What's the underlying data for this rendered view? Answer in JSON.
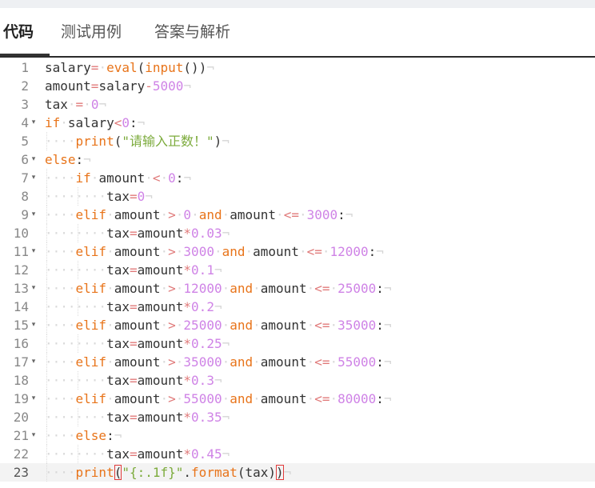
{
  "tabs": [
    {
      "label": "代码",
      "active": true
    },
    {
      "label": "测试用例",
      "active": false
    },
    {
      "label": "答案与解析",
      "active": false
    }
  ],
  "editor": {
    "indent_marker": "····",
    "eol_marker": "¬",
    "fold_marker": "▾",
    "active_line": 23,
    "colors": {
      "keyword": "#e8741a",
      "operator": "#e07a7a",
      "number": "#cf83e6",
      "string": "#7cab3c",
      "identifier": "#333333"
    },
    "lines": [
      {
        "n": "1",
        "indent": 0,
        "fold": false,
        "tokens": [
          [
            "ident",
            "salary"
          ],
          [
            "op",
            "="
          ],
          [
            "ws",
            "·"
          ],
          [
            "func",
            "eval"
          ],
          [
            "punct",
            "("
          ],
          [
            "func",
            "input"
          ],
          [
            "punct",
            "())"
          ]
        ]
      },
      {
        "n": "2",
        "indent": 0,
        "fold": false,
        "tokens": [
          [
            "ident",
            "amount"
          ],
          [
            "op",
            "="
          ],
          [
            "ident",
            "salary"
          ],
          [
            "op",
            "-"
          ],
          [
            "num",
            "5000"
          ]
        ]
      },
      {
        "n": "3",
        "indent": 0,
        "fold": false,
        "tokens": [
          [
            "ident",
            "tax"
          ],
          [
            "ws",
            "·"
          ],
          [
            "op",
            "="
          ],
          [
            "ws",
            "·"
          ],
          [
            "num",
            "0"
          ]
        ]
      },
      {
        "n": "4",
        "indent": 0,
        "fold": true,
        "tokens": [
          [
            "kw",
            "if"
          ],
          [
            "ws",
            "·"
          ],
          [
            "ident",
            "salary"
          ],
          [
            "op",
            "<"
          ],
          [
            "num",
            "0"
          ],
          [
            "punct",
            ":"
          ]
        ]
      },
      {
        "n": "5",
        "indent": 1,
        "fold": false,
        "tokens": [
          [
            "func",
            "print"
          ],
          [
            "punct",
            "("
          ],
          [
            "str",
            "\"请输入正数！\""
          ],
          [
            "punct",
            ")"
          ]
        ]
      },
      {
        "n": "6",
        "indent": 0,
        "fold": true,
        "tokens": [
          [
            "kw",
            "else"
          ],
          [
            "punct",
            ":"
          ]
        ]
      },
      {
        "n": "7",
        "indent": 1,
        "fold": true,
        "tokens": [
          [
            "kw",
            "if"
          ],
          [
            "ws",
            "·"
          ],
          [
            "ident",
            "amount"
          ],
          [
            "ws",
            "·"
          ],
          [
            "op",
            "<"
          ],
          [
            "ws",
            "·"
          ],
          [
            "num",
            "0"
          ],
          [
            "punct",
            ":"
          ]
        ]
      },
      {
        "n": "8",
        "indent": 2,
        "fold": false,
        "tokens": [
          [
            "ident",
            "tax"
          ],
          [
            "op",
            "="
          ],
          [
            "num",
            "0"
          ]
        ]
      },
      {
        "n": "9",
        "indent": 1,
        "fold": true,
        "tokens": [
          [
            "kw",
            "elif"
          ],
          [
            "ws",
            "·"
          ],
          [
            "ident",
            "amount"
          ],
          [
            "ws",
            "·"
          ],
          [
            "op",
            ">"
          ],
          [
            "ws",
            "·"
          ],
          [
            "num",
            "0"
          ],
          [
            "ws",
            "·"
          ],
          [
            "kw",
            "and"
          ],
          [
            "ws",
            "·"
          ],
          [
            "ident",
            "amount"
          ],
          [
            "ws",
            "·"
          ],
          [
            "op",
            "<="
          ],
          [
            "ws",
            "·"
          ],
          [
            "num",
            "3000"
          ],
          [
            "punct",
            ":"
          ]
        ]
      },
      {
        "n": "10",
        "indent": 2,
        "fold": false,
        "tokens": [
          [
            "ident",
            "tax"
          ],
          [
            "op",
            "="
          ],
          [
            "ident",
            "amount"
          ],
          [
            "op",
            "*"
          ],
          [
            "num",
            "0.03"
          ]
        ]
      },
      {
        "n": "11",
        "indent": 1,
        "fold": true,
        "tokens": [
          [
            "kw",
            "elif"
          ],
          [
            "ws",
            "·"
          ],
          [
            "ident",
            "amount"
          ],
          [
            "ws",
            "·"
          ],
          [
            "op",
            ">"
          ],
          [
            "ws",
            "·"
          ],
          [
            "num",
            "3000"
          ],
          [
            "ws",
            "·"
          ],
          [
            "kw",
            "and"
          ],
          [
            "ws",
            "·"
          ],
          [
            "ident",
            "amount"
          ],
          [
            "ws",
            "·"
          ],
          [
            "op",
            "<="
          ],
          [
            "ws",
            "·"
          ],
          [
            "num",
            "12000"
          ],
          [
            "punct",
            ":"
          ]
        ]
      },
      {
        "n": "12",
        "indent": 2,
        "fold": false,
        "tokens": [
          [
            "ident",
            "tax"
          ],
          [
            "op",
            "="
          ],
          [
            "ident",
            "amount"
          ],
          [
            "op",
            "*"
          ],
          [
            "num",
            "0.1"
          ]
        ]
      },
      {
        "n": "13",
        "indent": 1,
        "fold": true,
        "tokens": [
          [
            "kw",
            "elif"
          ],
          [
            "ws",
            "·"
          ],
          [
            "ident",
            "amount"
          ],
          [
            "ws",
            "·"
          ],
          [
            "op",
            ">"
          ],
          [
            "ws",
            "·"
          ],
          [
            "num",
            "12000"
          ],
          [
            "ws",
            "·"
          ],
          [
            "kw",
            "and"
          ],
          [
            "ws",
            "·"
          ],
          [
            "ident",
            "amount"
          ],
          [
            "ws",
            "·"
          ],
          [
            "op",
            "<="
          ],
          [
            "ws",
            "·"
          ],
          [
            "num",
            "25000"
          ],
          [
            "punct",
            ":"
          ]
        ]
      },
      {
        "n": "14",
        "indent": 2,
        "fold": false,
        "tokens": [
          [
            "ident",
            "tax"
          ],
          [
            "op",
            "="
          ],
          [
            "ident",
            "amount"
          ],
          [
            "op",
            "*"
          ],
          [
            "num",
            "0.2"
          ]
        ]
      },
      {
        "n": "15",
        "indent": 1,
        "fold": true,
        "tokens": [
          [
            "kw",
            "elif"
          ],
          [
            "ws",
            "·"
          ],
          [
            "ident",
            "amount"
          ],
          [
            "ws",
            "·"
          ],
          [
            "op",
            ">"
          ],
          [
            "ws",
            "·"
          ],
          [
            "num",
            "25000"
          ],
          [
            "ws",
            "·"
          ],
          [
            "kw",
            "and"
          ],
          [
            "ws",
            "·"
          ],
          [
            "ident",
            "amount"
          ],
          [
            "ws",
            "·"
          ],
          [
            "op",
            "<="
          ],
          [
            "ws",
            "·"
          ],
          [
            "num",
            "35000"
          ],
          [
            "punct",
            ":"
          ]
        ]
      },
      {
        "n": "16",
        "indent": 2,
        "fold": false,
        "tokens": [
          [
            "ident",
            "tax"
          ],
          [
            "op",
            "="
          ],
          [
            "ident",
            "amount"
          ],
          [
            "op",
            "*"
          ],
          [
            "num",
            "0.25"
          ]
        ]
      },
      {
        "n": "17",
        "indent": 1,
        "fold": true,
        "tokens": [
          [
            "kw",
            "elif"
          ],
          [
            "ws",
            "·"
          ],
          [
            "ident",
            "amount"
          ],
          [
            "ws",
            "·"
          ],
          [
            "op",
            ">"
          ],
          [
            "ws",
            "·"
          ],
          [
            "num",
            "35000"
          ],
          [
            "ws",
            "·"
          ],
          [
            "kw",
            "and"
          ],
          [
            "ws",
            "·"
          ],
          [
            "ident",
            "amount"
          ],
          [
            "ws",
            "·"
          ],
          [
            "op",
            "<="
          ],
          [
            "ws",
            "·"
          ],
          [
            "num",
            "55000"
          ],
          [
            "punct",
            ":"
          ]
        ]
      },
      {
        "n": "18",
        "indent": 2,
        "fold": false,
        "tokens": [
          [
            "ident",
            "tax"
          ],
          [
            "op",
            "="
          ],
          [
            "ident",
            "amount"
          ],
          [
            "op",
            "*"
          ],
          [
            "num",
            "0.3"
          ]
        ]
      },
      {
        "n": "19",
        "indent": 1,
        "fold": true,
        "tokens": [
          [
            "kw",
            "elif"
          ],
          [
            "ws",
            "·"
          ],
          [
            "ident",
            "amount"
          ],
          [
            "ws",
            "·"
          ],
          [
            "op",
            ">"
          ],
          [
            "ws",
            "·"
          ],
          [
            "num",
            "55000"
          ],
          [
            "ws",
            "·"
          ],
          [
            "kw",
            "and"
          ],
          [
            "ws",
            "·"
          ],
          [
            "ident",
            "amount"
          ],
          [
            "ws",
            "·"
          ],
          [
            "op",
            "<="
          ],
          [
            "ws",
            "·"
          ],
          [
            "num",
            "80000"
          ],
          [
            "punct",
            ":"
          ]
        ]
      },
      {
        "n": "20",
        "indent": 2,
        "fold": false,
        "tokens": [
          [
            "ident",
            "tax"
          ],
          [
            "op",
            "="
          ],
          [
            "ident",
            "amount"
          ],
          [
            "op",
            "*"
          ],
          [
            "num",
            "0.35"
          ]
        ]
      },
      {
        "n": "21",
        "indent": 1,
        "fold": true,
        "tokens": [
          [
            "kw",
            "else"
          ],
          [
            "punct",
            ":"
          ]
        ]
      },
      {
        "n": "22",
        "indent": 2,
        "fold": false,
        "tokens": [
          [
            "ident",
            "tax"
          ],
          [
            "op",
            "="
          ],
          [
            "ident",
            "amount"
          ],
          [
            "op",
            "*"
          ],
          [
            "num",
            "0.45"
          ]
        ]
      },
      {
        "n": "23",
        "indent": 1,
        "fold": false,
        "tokens": [
          [
            "func",
            "print"
          ],
          [
            "bracket",
            "("
          ],
          [
            "str",
            "\"{:.1f}\""
          ],
          [
            "punct",
            "."
          ],
          [
            "func",
            "format"
          ],
          [
            "punct",
            "(tax)"
          ],
          [
            "bracket",
            ")"
          ]
        ]
      }
    ]
  }
}
